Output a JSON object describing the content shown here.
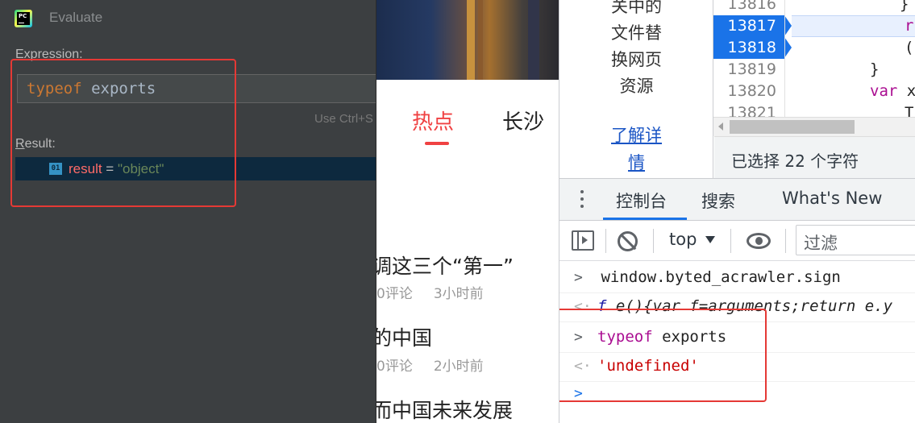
{
  "pycharm": {
    "logo_text": "PC",
    "title": "Evaluate",
    "expression_label": "Expression:",
    "expression_keyword": "typeof",
    "expression_rest": " exports",
    "hint": "Use Ctrl+S",
    "result_label_first": "R",
    "result_label_rest": "esult:",
    "result_icon": "01",
    "result_name": "result",
    "result_eq": " = ",
    "result_value": "\"object\""
  },
  "news": {
    "tab_hot": "热点",
    "tab_city": "长沙",
    "items": [
      {
        "title": "调这三个“第一”",
        "comments": "0评论",
        "time": "3小时前"
      },
      {
        "title": "的中国",
        "comments": "0评论",
        "time": "2小时前"
      },
      {
        "title": "而中国未来发展",
        "comments": "",
        "time": ""
      }
    ]
  },
  "devtools": {
    "sidebar_lines": [
      "关中的",
      "文件替",
      "换网页",
      "资源"
    ],
    "sidebar_link": [
      "了解详",
      "情"
    ],
    "line_numbers": [
      "13816",
      "13817",
      "13818",
      "13819",
      "13820",
      "13821"
    ],
    "highlighted_lines": [
      "13817",
      "13818"
    ],
    "code_lines": [
      {
        "parts": [
          {
            "text": "}",
            "kw": false
          }
        ]
      },
      {
        "parts": [
          {
            "text": "r",
            "kw": true
          }
        ]
      },
      {
        "parts": [
          {
            "text": "(",
            "kw": false
          }
        ]
      },
      {
        "parts": [
          {
            "text": "}",
            "kw": false
          }
        ]
      },
      {
        "parts": [
          {
            "text": "var",
            "kw": true
          },
          {
            "text": " x",
            "kw": false
          }
        ]
      },
      {
        "parts": [
          {
            "text": "T",
            "kw": false
          }
        ]
      }
    ],
    "status_text": "已选择 22 个字符",
    "tabs": {
      "console": "控制台",
      "search": "搜索",
      "whats_new": "What's New"
    },
    "toolbar": {
      "context": "top",
      "filter_placeholder": "过滤"
    },
    "console": {
      "cmd1": " window.byted_acrawler.sign",
      "out1_f": "f",
      "out1_rest": " e(){var f=arguments;return e.y",
      "cmd2_keyword": "typeof",
      "cmd2_rest": " exports",
      "out2": "'undefined'"
    }
  },
  "colors": {
    "annotation_red": "#e53935",
    "devtools_accent": "#1a73e8",
    "pycharm_bg": "#3c3f41",
    "news_accent": "#f04142"
  }
}
